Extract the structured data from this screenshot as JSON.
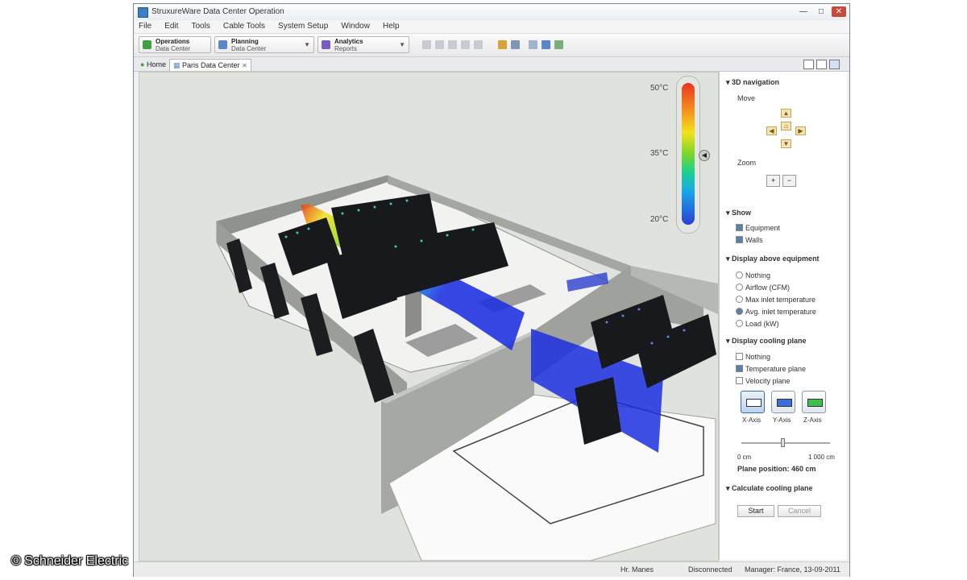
{
  "window": {
    "title": "StruxureWare Data Center Operation",
    "controls": {
      "minimize": "—",
      "maximize": "□",
      "close": "✕"
    }
  },
  "menu": [
    "File",
    "Edit",
    "Tools",
    "Cable Tools",
    "System Setup",
    "Window",
    "Help"
  ],
  "toolbar": {
    "buttons": [
      {
        "line1": "Operations",
        "line2": "Data Center",
        "icon": "green-plus-icon",
        "color": "#3fa142"
      },
      {
        "line1": "Planning",
        "line2": "Data Center",
        "icon": "planning-icon",
        "color": "#5b87c6"
      },
      {
        "line1": "Analytics",
        "line2": "Reports",
        "icon": "analytics-icon",
        "color": "#7a5bc4"
      }
    ]
  },
  "tabs": [
    {
      "label": "Home",
      "icon": "home-icon"
    },
    {
      "label": "Paris Data Center",
      "icon": "floorplan-icon",
      "close": "✕"
    }
  ],
  "legend": {
    "max": "50°C",
    "mid": "35°C",
    "min": "20°C",
    "colors": [
      "#e8351e",
      "#f58a1d",
      "#f2e21b",
      "#7ed52a",
      "#1fd38a",
      "#16a9e8",
      "#2b3fd6"
    ]
  },
  "panel": {
    "navigation": {
      "title": "3D navigation",
      "move_label": "Move",
      "zoom_label": "Zoom"
    },
    "show": {
      "title": "Show",
      "options": [
        {
          "label": "Equipment",
          "checked": true
        },
        {
          "label": "Walls",
          "checked": true
        }
      ]
    },
    "display_above": {
      "title": "Display above equipment",
      "options": [
        {
          "label": "Nothing",
          "selected": false
        },
        {
          "label": "Airflow (CFM)",
          "selected": false
        },
        {
          "label": "Max inlet temperature",
          "selected": false
        },
        {
          "label": "Avg. inlet temperature",
          "selected": true
        },
        {
          "label": "Load (kW)",
          "selected": false
        }
      ]
    },
    "cooling_plane": {
      "title": "Display cooling plane",
      "options": [
        {
          "label": "Nothing",
          "checked": false
        },
        {
          "label": "Temperature plane",
          "checked": true
        },
        {
          "label": "Velocity plane",
          "checked": false
        }
      ],
      "plane_labels": [
        "X-Axis",
        "Y-Axis",
        "Z-Axis"
      ],
      "slider_min": "0 cm",
      "slider_max": "1 000 cm",
      "slider_value": 0.46,
      "position_label": "Plane position: 460 cm"
    },
    "calculate": {
      "title": "Calculate cooling plane",
      "start_label": "Start",
      "cancel_label": "Cancel"
    }
  },
  "status": {
    "item1": "Hr. Manes",
    "item2": "Disconnected",
    "item3": "Manager: France, 13-09-2011"
  },
  "copyright": "© Schneider Electric"
}
